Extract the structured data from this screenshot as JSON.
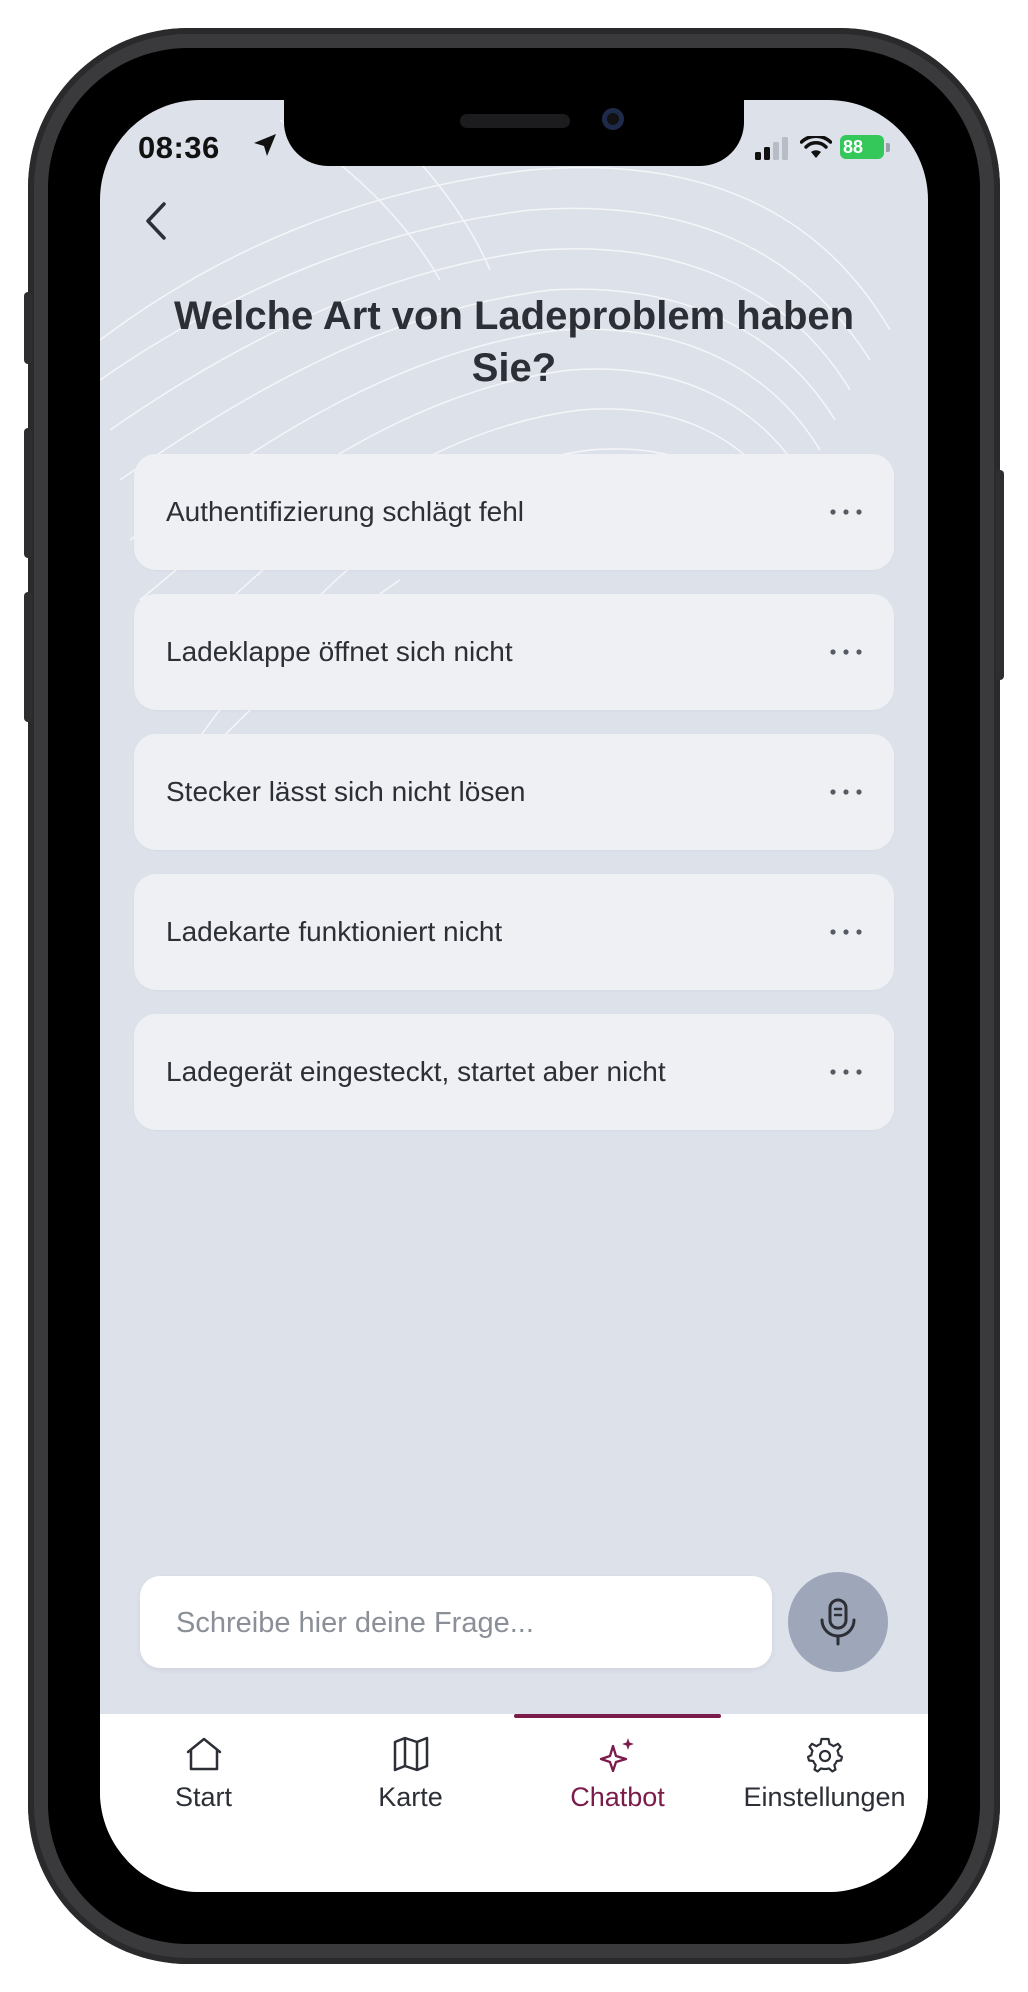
{
  "status_bar": {
    "time": "08:36",
    "battery": "88"
  },
  "page": {
    "question": "Welche Art von Ladeproblem haben Sie?"
  },
  "options": [
    {
      "label": "Authentifizierung schlägt fehl"
    },
    {
      "label": "Ladeklappe öffnet sich nicht"
    },
    {
      "label": "Stecker lässt sich nicht lösen"
    },
    {
      "label": "Ladekarte funktioniert nicht"
    },
    {
      "label": "Ladegerät eingesteckt, startet aber nicht"
    }
  ],
  "input": {
    "placeholder": "Schreibe hier deine Frage...",
    "value": ""
  },
  "tabs": [
    {
      "label": "Start",
      "icon": "home-icon",
      "active": false
    },
    {
      "label": "Karte",
      "icon": "map-icon",
      "active": false
    },
    {
      "label": "Chatbot",
      "icon": "sparkles-icon",
      "active": true
    },
    {
      "label": "Einstellungen",
      "icon": "gear-icon",
      "active": false
    }
  ],
  "colors": {
    "accent": "#7a1b4a",
    "background": "#dde1ea",
    "card": "#eff0f4",
    "mic_button": "#9ea6b9",
    "battery": "#34c759"
  }
}
